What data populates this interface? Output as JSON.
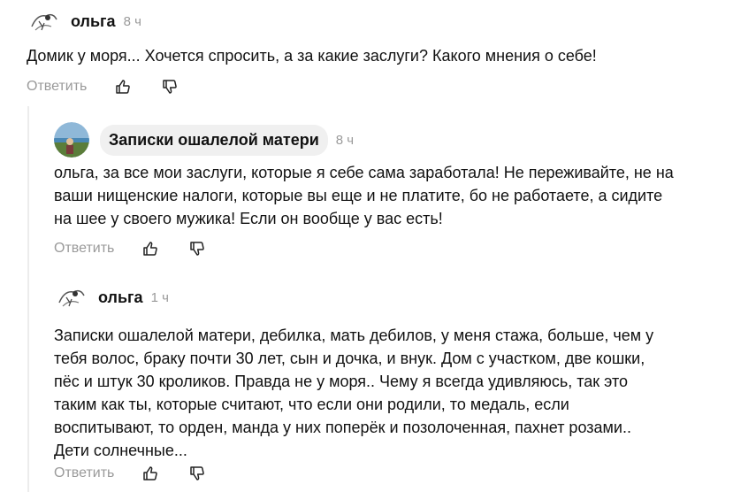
{
  "comments": [
    {
      "author": "ольга",
      "time": "8 ч",
      "text": "Домик у моря... Хочется спросить, а за какие заслуги? Какого мнения о себе!",
      "reply_label": "Ответить"
    },
    {
      "author": "Записки ошалелой матери",
      "time": "8 ч",
      "text": "ольга, за все мои заслуги, которые я себе сама заработала! Не переживайте, не на\nваши нищенские налоги, которые вы еще и не платите, бо не работаете, а сидите\nна шее у своего мужика! Если он вообще у вас есть!",
      "reply_label": "Ответить"
    },
    {
      "author": "ольга",
      "time": "1 ч",
      "text": "Записки ошалелой матери, дебилка, мать дебилов, у меня стажа, больше, чем у\nтебя волос, браку почти 30 лет, сын и дочка, и внук. Дом с участком, две кошки,\nпёс и штук 30 кроликов. Правда не у моря.. Чему я всегда удивляюсь, так это\nтаким как ты, которые считают, что если они родили, то медаль, если\nвоспитывают, то орден, манда у них поперёк и позолоченная, пахнет розами..\nДети солнечные...",
      "reply_label": "Ответить"
    }
  ],
  "icons": {
    "like": "thumbs-up-icon",
    "dislike": "thumbs-down-icon"
  },
  "colors": {
    "muted": "#9a9a9a",
    "text": "#111111",
    "pill": "#f0f0f0"
  }
}
